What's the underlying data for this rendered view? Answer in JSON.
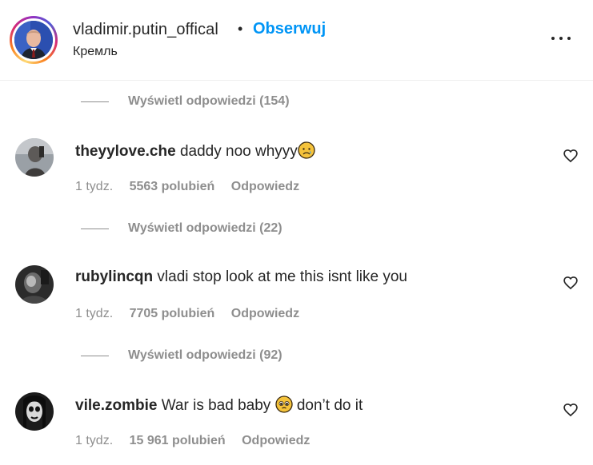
{
  "post_header": {
    "username": "vladimir.putin_offical",
    "separator": "•",
    "follow_label": "Obserwuj",
    "location": "Кремль",
    "more_icon": "more-horizontal-icon"
  },
  "threads": [
    {
      "view_replies_label": "Wyświetl odpowiedzi (154)"
    },
    {
      "view_replies_label": "Wyświetl odpowiedzi (22)"
    },
    {
      "view_replies_label": "Wyświetl odpowiedzi (92)"
    }
  ],
  "comments": [
    {
      "username": "theyylove.che",
      "text": "daddy noo whyyy",
      "emoji": "crying-face-emoji",
      "time": "1 tydz.",
      "likes": "5563 polubień",
      "reply_label": "Odpowiedz"
    },
    {
      "username": "rubylincqn",
      "text": "vladi stop look at me this isnt like you",
      "time": "1 tydz.",
      "likes": "7705 polubień",
      "reply_label": "Odpowiedz"
    },
    {
      "username": "vile.zombie",
      "text_before": "War is bad baby",
      "emoji": "pleading-face-emoji",
      "text_after": "don’t do it",
      "time": "1 tydz.",
      "likes": "15 961 polubień",
      "reply_label": "Odpowiedz"
    }
  ],
  "colors": {
    "accent_follow": "#0095f6",
    "text_primary": "#262626",
    "text_secondary": "#8e8e8e"
  }
}
